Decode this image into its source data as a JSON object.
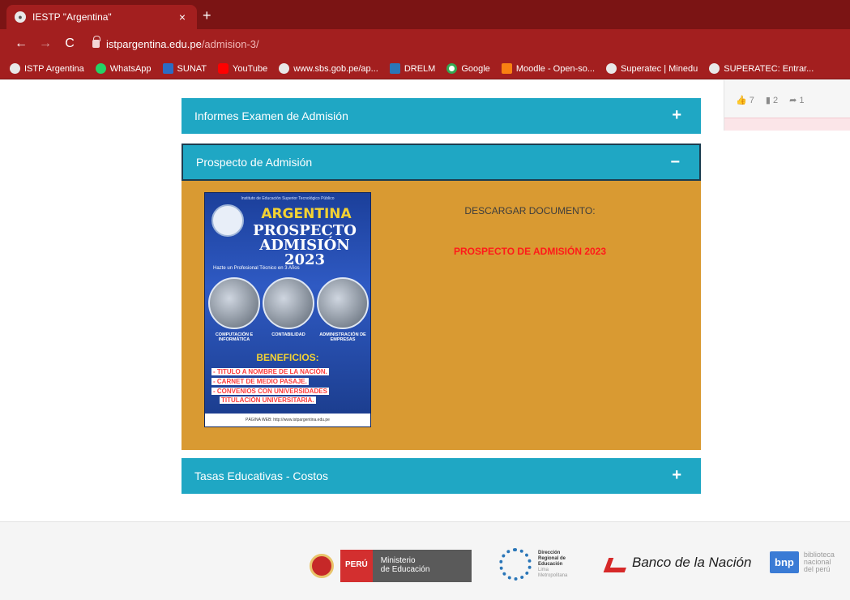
{
  "browser": {
    "tab_title": "IESTP \"Argentina\"",
    "tab_close": "×",
    "new_tab": "+",
    "back": "←",
    "forward": "→",
    "reload": "C",
    "url_host": "istpargentina.edu.pe",
    "url_path": "/admision-3/",
    "bookmarks": [
      {
        "label": "ISTP Argentina",
        "icon": "globe-icon",
        "color": "#e8e8e8"
      },
      {
        "label": "WhatsApp",
        "icon": "whatsapp-icon",
        "color": "#25d366"
      },
      {
        "label": "SUNAT",
        "icon": "sunat-icon",
        "color": "#2b6cc4"
      },
      {
        "label": "YouTube",
        "icon": "youtube-icon",
        "color": "#ff0000"
      },
      {
        "label": "www.sbs.gob.pe/ap...",
        "icon": "globe-icon",
        "color": "#e8e8e8"
      },
      {
        "label": "DRELM",
        "icon": "drelm-icon",
        "color": "#2a76b8"
      },
      {
        "label": "Google",
        "icon": "google-icon",
        "color": "#ffffff"
      },
      {
        "label": "Moodle - Open-so...",
        "icon": "moodle-icon",
        "color": "#f98012"
      },
      {
        "label": "Superatec | Minedu",
        "icon": "globe-icon",
        "color": "#e8e8e8"
      },
      {
        "label": "SUPERATEC: Entrar...",
        "icon": "globe-icon",
        "color": "#e8e8e8"
      }
    ]
  },
  "side": {
    "likes": "7",
    "comments": "2",
    "shares": "1"
  },
  "accordion": [
    {
      "label": "Informes Examen de Admisión",
      "sign": "+"
    },
    {
      "label": "Prospecto de Admisión",
      "sign": "−"
    },
    {
      "label": "Tasas Educativas - Costos",
      "sign": "+"
    }
  ],
  "prospecto": {
    "download_title": "DESCARGAR DOCUMENTO:",
    "download_link": "PROSPECTO DE ADMISIÓN 2023"
  },
  "poster": {
    "top_line": "Instituto de Educación Superior Tecnológico Público",
    "name": "ARGENTINA",
    "title_line1": "PROSPECTO",
    "title_line2": "ADMISIÓN 2023",
    "tagline": "Hazte un Profesional Técnico en 3 Años",
    "areas": [
      "COMPUTACIÓN E INFORMÁTICA",
      "CONTABILIDAD",
      "ADMINISTRACIÓN DE EMPRESAS"
    ],
    "benefits_title": "BENEFICIOS:",
    "benefits": [
      "- TITULO A NOMBRE DE LA NACIÓN.",
      "- CARNET DE MEDIO PASAJE.",
      "- CONVENIOS CON UNIVERSIDADES",
      "TITULACIÓN UNIVERSITARIA."
    ],
    "footer": "PÁGINA WEB: http://www.istpargentina.edu.pe"
  },
  "footer": {
    "peru": "PERÚ",
    "minedu_line1": "Ministerio",
    "minedu_line2": "de Educación",
    "drelm_line1": "Dirección",
    "drelm_line2": "Regional de",
    "drelm_line3": "Educación",
    "drelm_line4": "Lima",
    "drelm_line5": "Metropolitana",
    "bn": "Banco de la Nación",
    "bnp_box": "bnp",
    "bnp_line1": "biblioteca",
    "bnp_line2": "nacional",
    "bnp_line3": "del perú"
  }
}
